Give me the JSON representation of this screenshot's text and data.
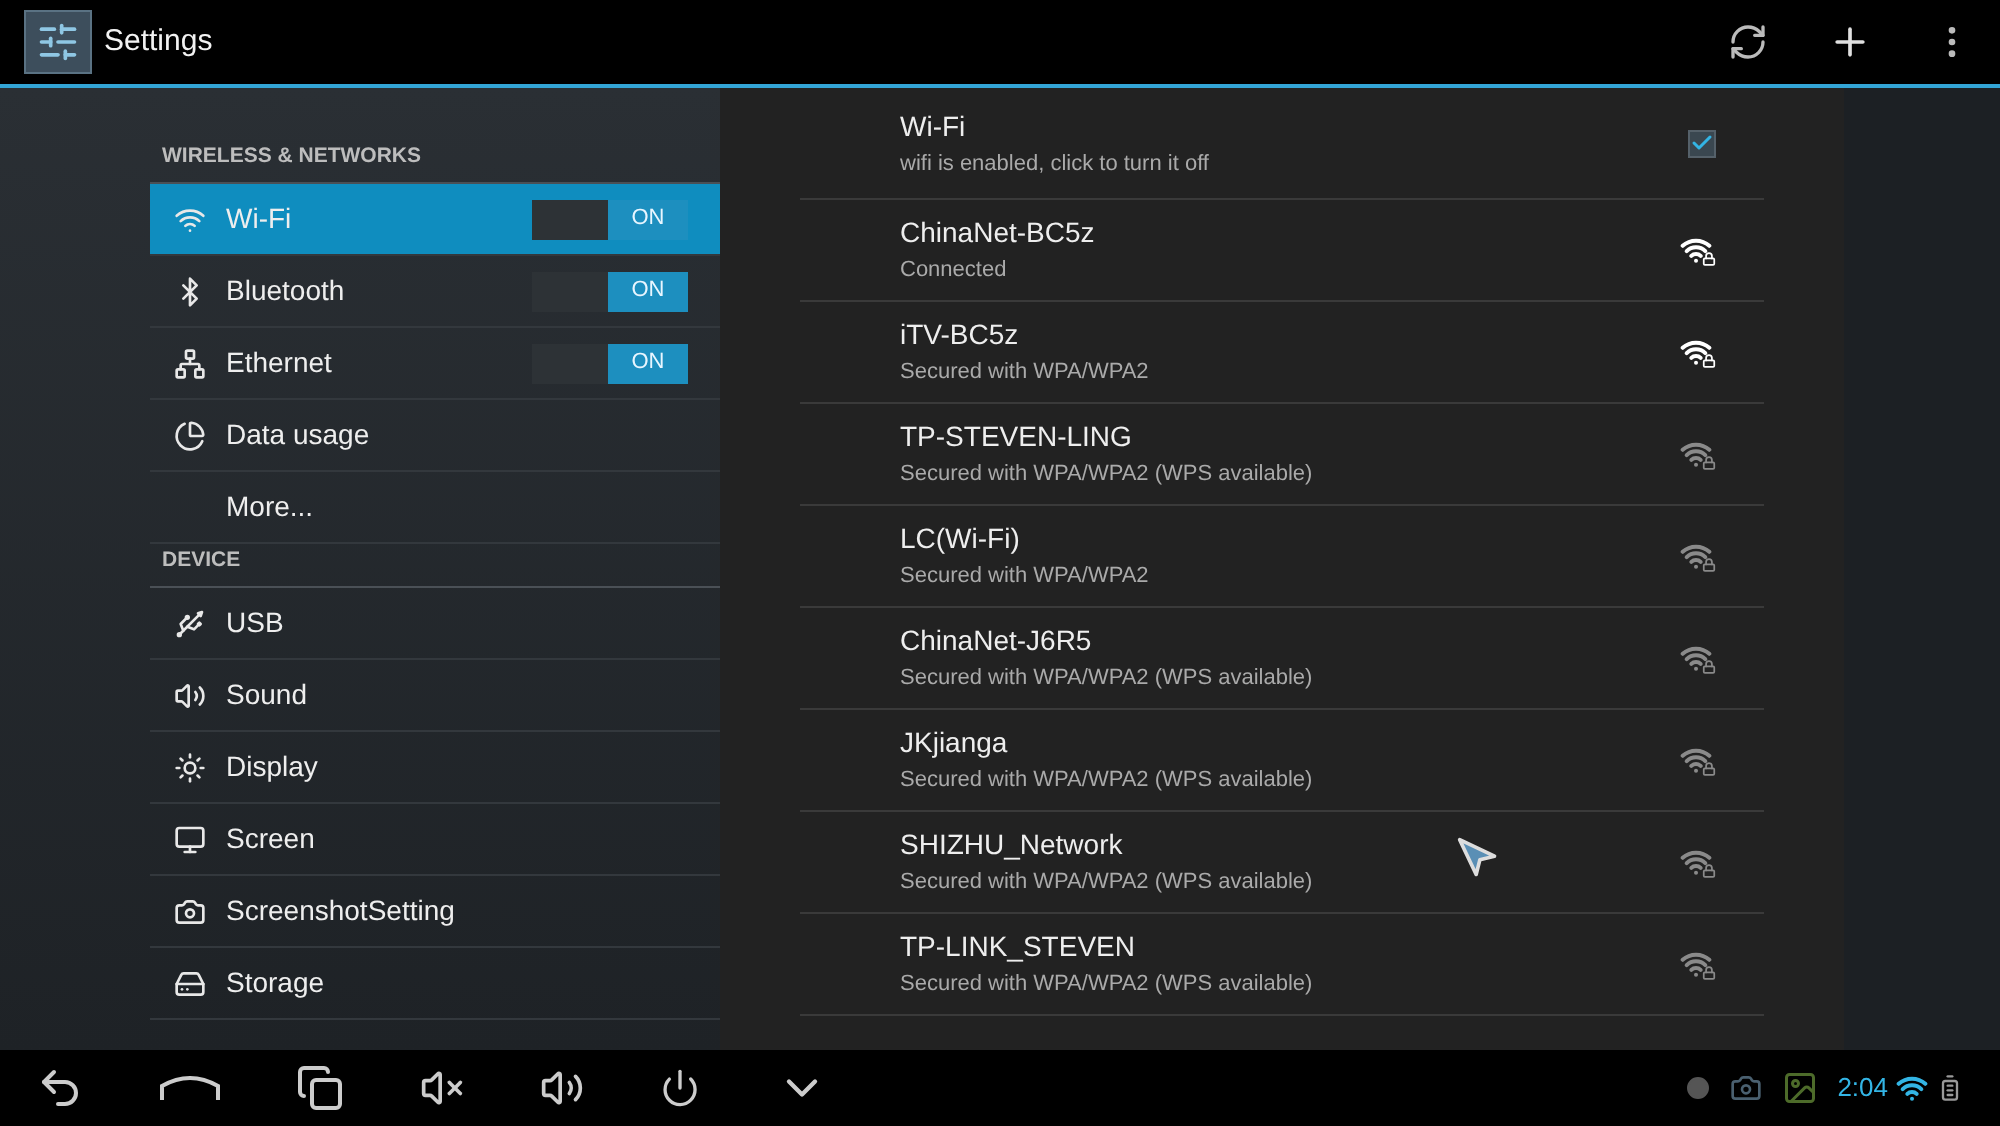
{
  "action_bar": {
    "title": "Settings"
  },
  "sidebar": {
    "sections": [
      {
        "header": "WIRELESS & NETWORKS",
        "items": [
          {
            "kind": "wifi",
            "label": "Wi-Fi",
            "selected": true,
            "toggle": {
              "on": true,
              "label": "ON"
            }
          },
          {
            "kind": "bluetooth",
            "label": "Bluetooth",
            "selected": false,
            "toggle": {
              "on": true,
              "label": "ON"
            }
          },
          {
            "kind": "ethernet",
            "label": "Ethernet",
            "selected": false,
            "toggle": {
              "on": true,
              "label": "ON"
            }
          },
          {
            "kind": "data",
            "label": "Data usage",
            "selected": false
          },
          {
            "kind": "more",
            "label": "More...",
            "selected": false
          }
        ]
      },
      {
        "header": "DEVICE",
        "items": [
          {
            "kind": "usb",
            "label": "USB",
            "selected": false
          },
          {
            "kind": "sound",
            "label": "Sound",
            "selected": false
          },
          {
            "kind": "display",
            "label": "Display",
            "selected": false
          },
          {
            "kind": "screen",
            "label": "Screen",
            "selected": false
          },
          {
            "kind": "screenshot",
            "label": "ScreenshotSetting",
            "selected": false
          },
          {
            "kind": "storage",
            "label": "Storage",
            "selected": false
          }
        ]
      }
    ]
  },
  "wifi_panel": {
    "master": {
      "title": "Wi-Fi",
      "summary": "wifi is enabled, click to turn it off",
      "checked": true
    },
    "networks": [
      {
        "name": "ChinaNet-BC5z",
        "status": "Connected",
        "kind": "strong"
      },
      {
        "name": "iTV-BC5z",
        "status": "Secured with WPA/WPA2",
        "kind": "strong"
      },
      {
        "name": "TP-STEVEN-LING",
        "status": "Secured with WPA/WPA2 (WPS available)",
        "kind": "weak"
      },
      {
        "name": "LC(Wi-Fi)",
        "status": "Secured with WPA/WPA2",
        "kind": "weak"
      },
      {
        "name": "ChinaNet-J6R5",
        "status": "Secured with WPA/WPA2 (WPS available)",
        "kind": "weak"
      },
      {
        "name": "JKjianga",
        "status": "Secured with WPA/WPA2 (WPS available)",
        "kind": "weak"
      },
      {
        "name": "SHIZHU_Network",
        "status": "Secured with WPA/WPA2 (WPS available)",
        "kind": "weak"
      },
      {
        "name": "TP-LINK_STEVEN",
        "status": "Secured with WPA/WPA2 (WPS available)",
        "kind": "weak"
      }
    ]
  },
  "status_bar": {
    "time": "2:04"
  }
}
